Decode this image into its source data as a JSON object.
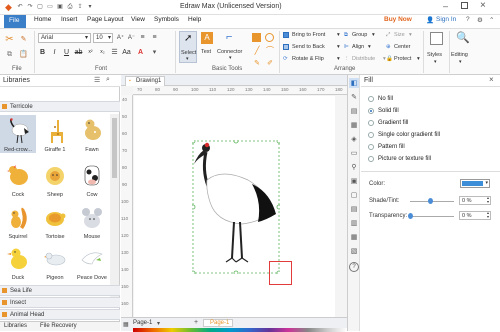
{
  "app": {
    "title": "Edraw Max (Unlicensed Version)",
    "buy_now": "Buy Now",
    "sign_in": "Sign In"
  },
  "menu": [
    "File",
    "Home",
    "Insert",
    "Page Layout",
    "View",
    "Symbols",
    "Help"
  ],
  "ribbon": {
    "font_name": "Arial",
    "font_size": "10",
    "groups": {
      "file": "File",
      "font": "Font",
      "basic_tools": "Basic Tools",
      "arrange": "Arrange"
    },
    "tools": {
      "select": "Select",
      "text": "Text",
      "connector": "Connector"
    },
    "arrange": {
      "bring_front": "Bring to Front",
      "send_back": "Send to Back",
      "rotate_flip": "Rotate & Flip",
      "group": "Group",
      "align": "Align",
      "distribute": "Distribute",
      "size": "Size",
      "center": "Center",
      "protect": "Protect"
    },
    "styles": "Styles",
    "editing": "Editing"
  },
  "libraries": {
    "title": "Libraries",
    "category": "Terricole",
    "items": [
      {
        "label": "Red-crow..."
      },
      {
        "label": "Giraffe 1"
      },
      {
        "label": "Fawn"
      },
      {
        "label": "Cock"
      },
      {
        "label": "Sheep"
      },
      {
        "label": "Cow"
      },
      {
        "label": "Squirrel"
      },
      {
        "label": "Tortoise"
      },
      {
        "label": "Mouse"
      },
      {
        "label": "Duck"
      },
      {
        "label": "Pigeon"
      },
      {
        "label": "Peace Dove"
      }
    ],
    "sections": [
      "Sea Life",
      "Insect",
      "Animal Head"
    ],
    "tabs": [
      "Libraries",
      "File Recovery"
    ]
  },
  "canvas": {
    "tab": "Drawing1",
    "ruler_top": [
      "70",
      "80",
      "90",
      "100",
      "110",
      "120",
      "130",
      "140",
      "150",
      "160",
      "170",
      "180"
    ],
    "ruler_left": [
      "40",
      "50",
      "60",
      "70",
      "80",
      "90",
      "100",
      "110",
      "120",
      "130",
      "140",
      "150",
      "160"
    ],
    "page_tabs": [
      "Page-1",
      "Page-1"
    ]
  },
  "fill": {
    "title": "Fill",
    "options": [
      "No fill",
      "Solid fill",
      "Gradient fill",
      "Single color gradient fill",
      "Pattern fill",
      "Picture or texture fill"
    ],
    "selected": "Solid fill",
    "color_label": "Color:",
    "color_value": "#3d8ed8",
    "shade_label": "Shade/Tint:",
    "shade_value": "0 %",
    "transparency_label": "Transparency:",
    "transparency_value": "0 %"
  }
}
